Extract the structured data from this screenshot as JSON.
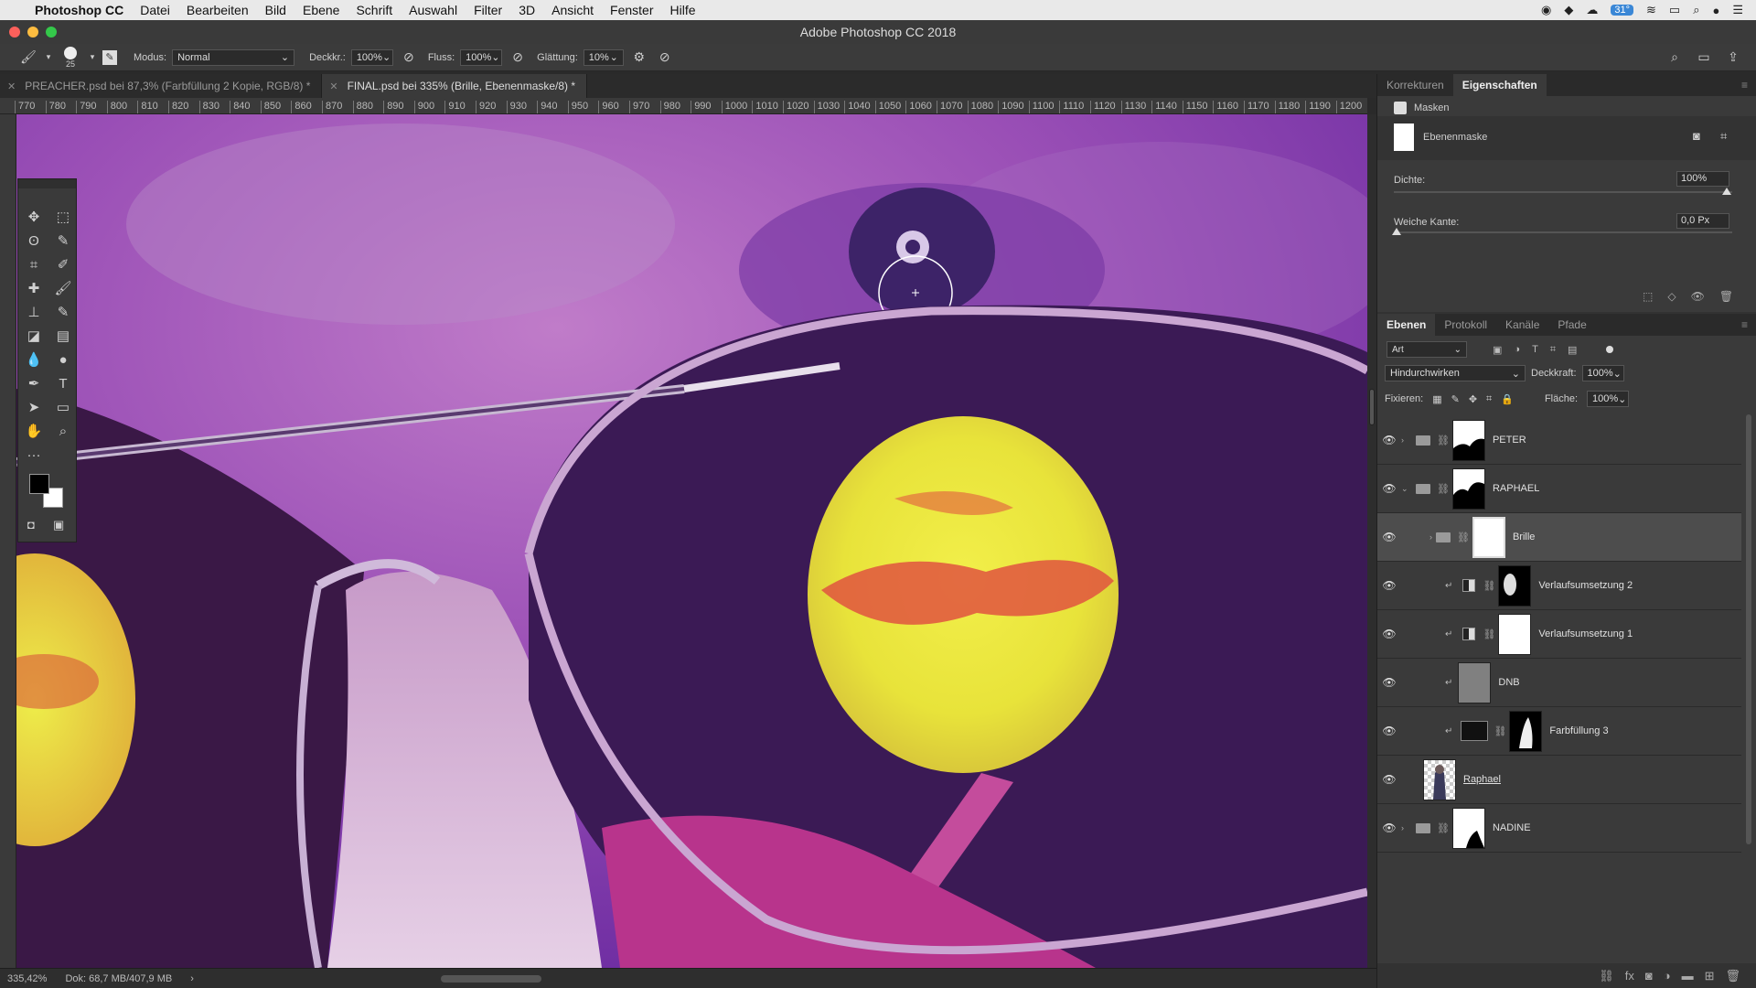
{
  "menubar": {
    "app_name": "Photoshop CC",
    "items": [
      "Datei",
      "Bearbeiten",
      "Bild",
      "Ebene",
      "Schrift",
      "Auswahl",
      "Filter",
      "3D",
      "Ansicht",
      "Fenster",
      "Hilfe"
    ],
    "status_battery": "31°"
  },
  "window": {
    "title": "Adobe Photoshop CC 2018"
  },
  "options": {
    "brush_size": "25",
    "mode_label": "Modus:",
    "mode_value": "Normal",
    "opacity_label": "Deckkr.:",
    "opacity_value": "100%",
    "flow_label": "Fluss:",
    "flow_value": "100%",
    "smoothing_label": "Glättung:",
    "smoothing_value": "10%"
  },
  "tabs": [
    {
      "label": "PREACHER.psd bei 87,3% (Farbfüllung 2 Kopie, RGB/8) *"
    },
    {
      "label": "FINAL.psd bei 335% (Brille, Ebenenmaske/8) *"
    }
  ],
  "ruler": {
    "ticks": [
      "770",
      "780",
      "790",
      "800",
      "810",
      "820",
      "830",
      "840",
      "850",
      "860",
      "870",
      "880",
      "890",
      "900",
      "910",
      "920",
      "930",
      "940",
      "950",
      "960",
      "970",
      "980",
      "990",
      "1000",
      "1010",
      "1020",
      "1030",
      "1040",
      "1050",
      "1060",
      "1070",
      "1080",
      "1090",
      "1100",
      "1110",
      "1120",
      "1130",
      "1140",
      "1150",
      "1160",
      "1170",
      "1180",
      "1190",
      "1200"
    ]
  },
  "status": {
    "zoom": "335,42%",
    "doc": "Dok: 68,7 MB/407,9 MB"
  },
  "properties_panel": {
    "tabs": [
      "Korrekturen",
      "Eigenschaften"
    ],
    "section": "Masken",
    "mask_type": "Ebenenmaske",
    "density_label": "Dichte:",
    "density_value": "100%",
    "feather_label": "Weiche Kante:",
    "feather_value": "0,0 Px"
  },
  "layers_panel": {
    "tabs": [
      "Ebenen",
      "Protokoll",
      "Kanäle",
      "Pfade"
    ],
    "filter_kind": "Art",
    "blend_mode": "Hindurchwirken",
    "opacity_label": "Deckkraft:",
    "opacity_value": "100%",
    "lock_label": "Fixieren:",
    "fill_label": "Fläche:",
    "fill_value": "100%",
    "layers": [
      {
        "name": "PETER"
      },
      {
        "name": "RAPHAEL"
      },
      {
        "name": "Brille"
      },
      {
        "name": "Verlaufsumsetzung 2"
      },
      {
        "name": "Verlaufsumsetzung 1"
      },
      {
        "name": "DNB"
      },
      {
        "name": "Farbfüllung 3"
      },
      {
        "name": "Raphael"
      },
      {
        "name": "NADINE"
      }
    ]
  }
}
